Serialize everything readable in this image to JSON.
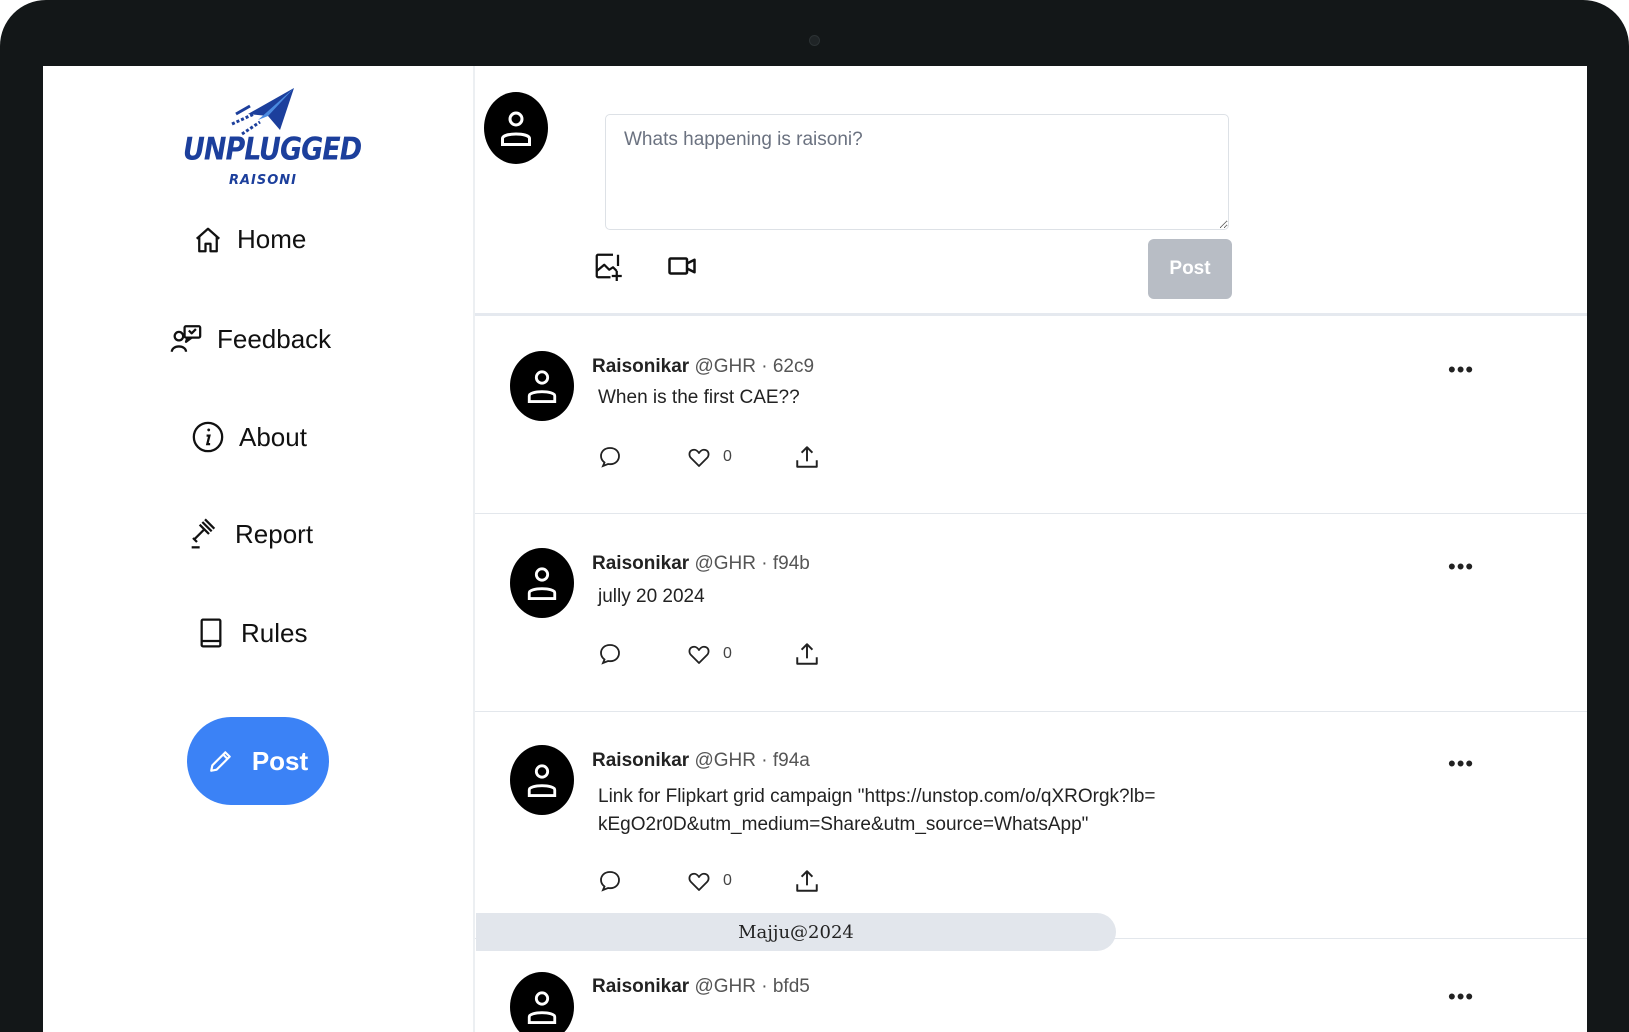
{
  "brand": {
    "name": "UNPLUGGED",
    "sub": "RAISONI"
  },
  "sidebar": {
    "items": [
      {
        "label": "Home",
        "icon": "home-icon"
      },
      {
        "label": "Feedback",
        "icon": "feedback-icon"
      },
      {
        "label": "About",
        "icon": "info-icon"
      },
      {
        "label": "Report",
        "icon": "gavel-icon"
      },
      {
        "label": "Rules",
        "icon": "book-icon"
      }
    ],
    "post_button": "Post"
  },
  "composer": {
    "placeholder": "Whats happening is raisoni?",
    "post_label": "Post"
  },
  "posts": [
    {
      "name": "Raisonikar",
      "handle": "@GHR",
      "id": "62c9",
      "text": "When is the first CAE??",
      "likes": "0"
    },
    {
      "name": "Raisonikar",
      "handle": "@GHR",
      "id": "f94b",
      "text": "jully 20 2024",
      "likes": "0"
    },
    {
      "name": "Raisonikar",
      "handle": "@GHR",
      "id": "f94a",
      "text": "Link for Flipkart grid campaign \"https://unstop.com/o/qXROrgk?lb=kEgO2r0D&utm_medium=Share&utm_source=WhatsApp\"",
      "likes": "0"
    },
    {
      "name": "Raisonikar",
      "handle": "@GHR",
      "id": "bfd5",
      "text": "",
      "likes": ""
    }
  ],
  "toast": "Majju@2024",
  "colors": {
    "accent": "#3b82f6",
    "brand": "#1c3f9c",
    "disabled": "#b8bdc5"
  }
}
